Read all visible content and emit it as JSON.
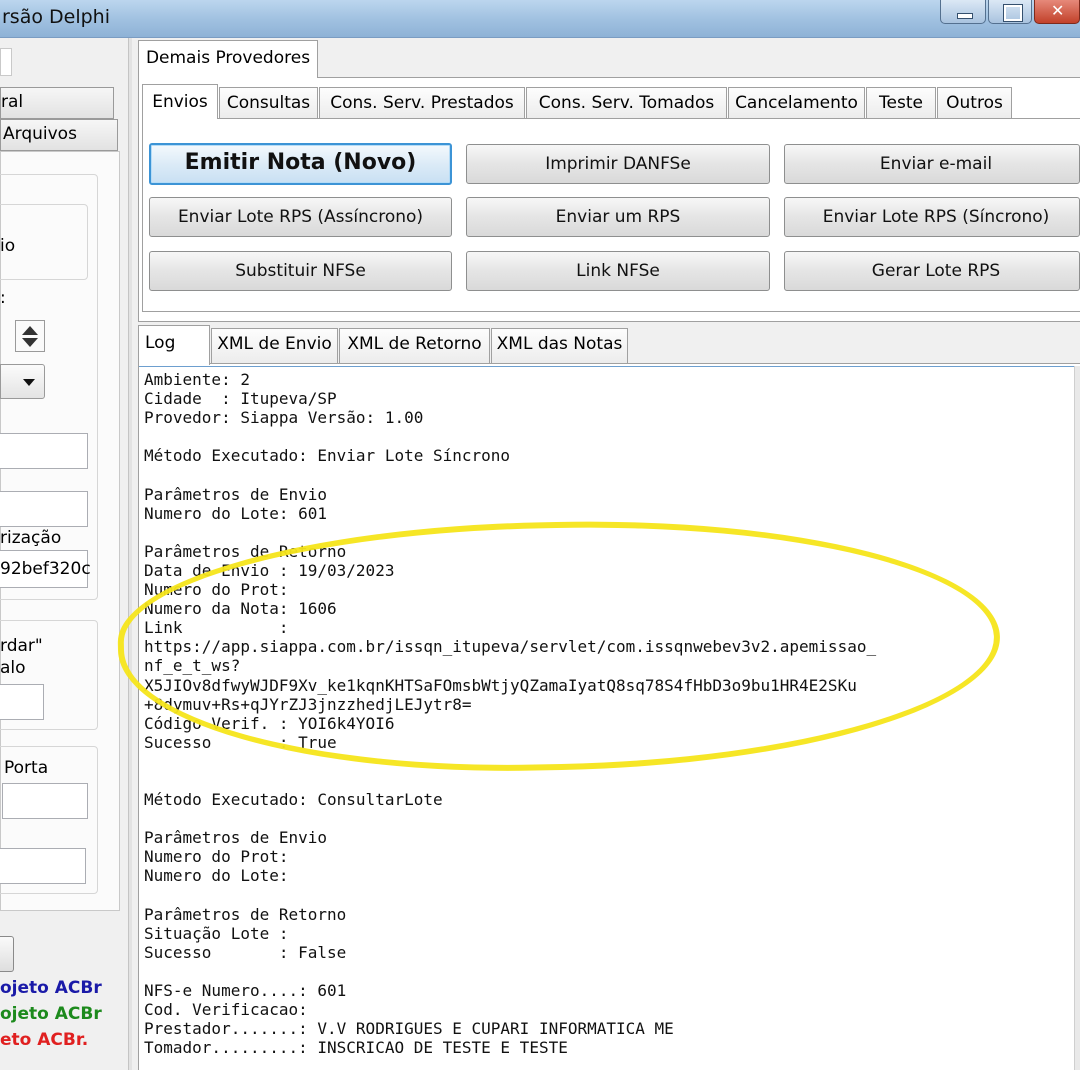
{
  "window": {
    "title": "rsão Delphi",
    "accent_color": "#f5e51a"
  },
  "left_panel": {
    "tabs": [
      "ral",
      "Arquivos"
    ],
    "labels": {
      "io": "io",
      "colon": ":",
      "rizacao": "rização",
      "rizacao_value": "92bef320c",
      "rdar": "rdar\"",
      "alo": "alo",
      "porta": "Porta"
    },
    "footer_lines": [
      {
        "text": "ojeto ACBr",
        "color": "#1a1aa8"
      },
      {
        "text": "ojeto ACBr",
        "color": "#1c8a1c"
      },
      {
        "text": "eto ACBr.",
        "color": "#e02020"
      }
    ]
  },
  "top_tabs": [
    "Demais Provedores"
  ],
  "service_tabs": [
    "Envios",
    "Consultas",
    "Cons. Serv. Prestados",
    "Cons. Serv. Tomados",
    "Cancelamento",
    "Teste",
    "Outros"
  ],
  "buttons": {
    "emitir_nota": "Emitir Nota (Novo)",
    "imprimir_danfse": "Imprimir DANFSe",
    "enviar_email": "Enviar e-mail",
    "enviar_lote_assincrono": "Enviar Lote RPS (Assíncrono)",
    "enviar_um_rps": "Enviar um RPS",
    "enviar_lote_sincrono": "Enviar Lote RPS (Síncrono)",
    "substituir_nfse": "Substituir NFSe",
    "link_nfse": "Link NFSe",
    "gerar_lote_rps": "Gerar Lote RPS"
  },
  "log_tabs": [
    "Log",
    "XML de Envio",
    "XML de Retorno",
    "XML das Notas"
  ],
  "log_lines": [
    "Ambiente: 2",
    "Cidade  : Itupeva/SP",
    "Provedor: Siappa Versão: 1.00",
    "",
    "Método Executado: Enviar Lote Síncrono",
    "",
    "Parâmetros de Envio",
    "Numero do Lote: 601",
    "",
    "Parâmetros de Retorno",
    "Data de Envio : 19/03/2023",
    "Numero do Prot:",
    "Numero da Nota: 1606",
    "Link          :",
    "https://app.siappa.com.br/issqn_itupeva/servlet/com.issqnwebev3v2.apemissao_",
    "nf_e_t_ws?",
    "X5JIOv8dfwyWJDF9Xv_ke1kqnKHTSaFOmsbWtjyQZamaIyatQ8sq78S4fHbD3o9bu1HR4E2SKu",
    "+8dymuv+Rs+qJYrZJ3jnzzhedjLEJytr8=",
    "Código Verif. : YOI6k4YOI6",
    "Sucesso       : True",
    "",
    "",
    "Método Executado: ConsultarLote",
    "",
    "Parâmetros de Envio",
    "Numero do Prot:",
    "Numero do Lote:",
    "",
    "Parâmetros de Retorno",
    "Situação Lote :",
    "Sucesso       : False",
    "",
    "NFS-e Numero....: 601",
    "Cod. Verificacao:",
    "Prestador.......: V.V RODRIGUES E CUPARI INFORMATICA ME",
    "Tomador.........: INSCRICAO DE TESTE E TESTE"
  ]
}
